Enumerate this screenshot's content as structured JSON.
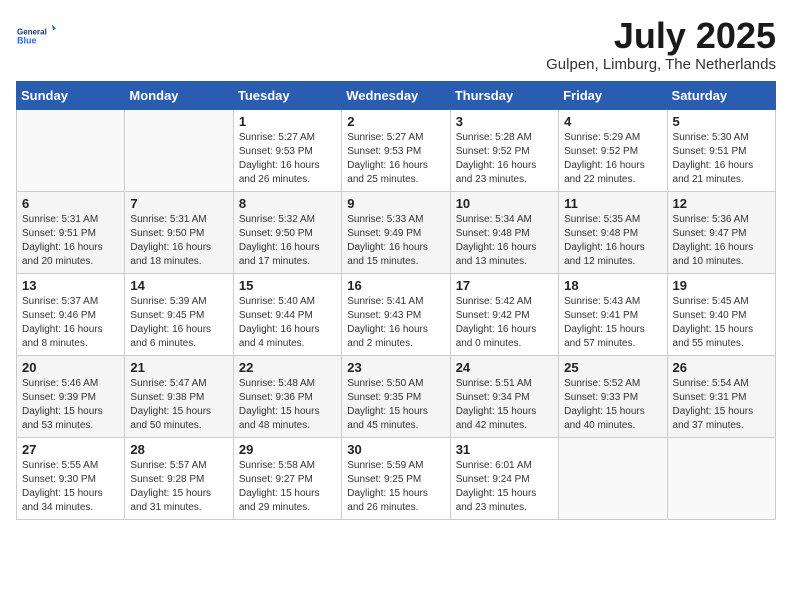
{
  "header": {
    "logo_line1": "General",
    "logo_line2": "Blue",
    "month_title": "July 2025",
    "location": "Gulpen, Limburg, The Netherlands"
  },
  "weekdays": [
    "Sunday",
    "Monday",
    "Tuesday",
    "Wednesday",
    "Thursday",
    "Friday",
    "Saturday"
  ],
  "weeks": [
    [
      {
        "day": "",
        "info": ""
      },
      {
        "day": "",
        "info": ""
      },
      {
        "day": "1",
        "info": "Sunrise: 5:27 AM\nSunset: 9:53 PM\nDaylight: 16 hours\nand 26 minutes."
      },
      {
        "day": "2",
        "info": "Sunrise: 5:27 AM\nSunset: 9:53 PM\nDaylight: 16 hours\nand 25 minutes."
      },
      {
        "day": "3",
        "info": "Sunrise: 5:28 AM\nSunset: 9:52 PM\nDaylight: 16 hours\nand 23 minutes."
      },
      {
        "day": "4",
        "info": "Sunrise: 5:29 AM\nSunset: 9:52 PM\nDaylight: 16 hours\nand 22 minutes."
      },
      {
        "day": "5",
        "info": "Sunrise: 5:30 AM\nSunset: 9:51 PM\nDaylight: 16 hours\nand 21 minutes."
      }
    ],
    [
      {
        "day": "6",
        "info": "Sunrise: 5:31 AM\nSunset: 9:51 PM\nDaylight: 16 hours\nand 20 minutes."
      },
      {
        "day": "7",
        "info": "Sunrise: 5:31 AM\nSunset: 9:50 PM\nDaylight: 16 hours\nand 18 minutes."
      },
      {
        "day": "8",
        "info": "Sunrise: 5:32 AM\nSunset: 9:50 PM\nDaylight: 16 hours\nand 17 minutes."
      },
      {
        "day": "9",
        "info": "Sunrise: 5:33 AM\nSunset: 9:49 PM\nDaylight: 16 hours\nand 15 minutes."
      },
      {
        "day": "10",
        "info": "Sunrise: 5:34 AM\nSunset: 9:48 PM\nDaylight: 16 hours\nand 13 minutes."
      },
      {
        "day": "11",
        "info": "Sunrise: 5:35 AM\nSunset: 9:48 PM\nDaylight: 16 hours\nand 12 minutes."
      },
      {
        "day": "12",
        "info": "Sunrise: 5:36 AM\nSunset: 9:47 PM\nDaylight: 16 hours\nand 10 minutes."
      }
    ],
    [
      {
        "day": "13",
        "info": "Sunrise: 5:37 AM\nSunset: 9:46 PM\nDaylight: 16 hours\nand 8 minutes."
      },
      {
        "day": "14",
        "info": "Sunrise: 5:39 AM\nSunset: 9:45 PM\nDaylight: 16 hours\nand 6 minutes."
      },
      {
        "day": "15",
        "info": "Sunrise: 5:40 AM\nSunset: 9:44 PM\nDaylight: 16 hours\nand 4 minutes."
      },
      {
        "day": "16",
        "info": "Sunrise: 5:41 AM\nSunset: 9:43 PM\nDaylight: 16 hours\nand 2 minutes."
      },
      {
        "day": "17",
        "info": "Sunrise: 5:42 AM\nSunset: 9:42 PM\nDaylight: 16 hours\nand 0 minutes."
      },
      {
        "day": "18",
        "info": "Sunrise: 5:43 AM\nSunset: 9:41 PM\nDaylight: 15 hours\nand 57 minutes."
      },
      {
        "day": "19",
        "info": "Sunrise: 5:45 AM\nSunset: 9:40 PM\nDaylight: 15 hours\nand 55 minutes."
      }
    ],
    [
      {
        "day": "20",
        "info": "Sunrise: 5:46 AM\nSunset: 9:39 PM\nDaylight: 15 hours\nand 53 minutes."
      },
      {
        "day": "21",
        "info": "Sunrise: 5:47 AM\nSunset: 9:38 PM\nDaylight: 15 hours\nand 50 minutes."
      },
      {
        "day": "22",
        "info": "Sunrise: 5:48 AM\nSunset: 9:36 PM\nDaylight: 15 hours\nand 48 minutes."
      },
      {
        "day": "23",
        "info": "Sunrise: 5:50 AM\nSunset: 9:35 PM\nDaylight: 15 hours\nand 45 minutes."
      },
      {
        "day": "24",
        "info": "Sunrise: 5:51 AM\nSunset: 9:34 PM\nDaylight: 15 hours\nand 42 minutes."
      },
      {
        "day": "25",
        "info": "Sunrise: 5:52 AM\nSunset: 9:33 PM\nDaylight: 15 hours\nand 40 minutes."
      },
      {
        "day": "26",
        "info": "Sunrise: 5:54 AM\nSunset: 9:31 PM\nDaylight: 15 hours\nand 37 minutes."
      }
    ],
    [
      {
        "day": "27",
        "info": "Sunrise: 5:55 AM\nSunset: 9:30 PM\nDaylight: 15 hours\nand 34 minutes."
      },
      {
        "day": "28",
        "info": "Sunrise: 5:57 AM\nSunset: 9:28 PM\nDaylight: 15 hours\nand 31 minutes."
      },
      {
        "day": "29",
        "info": "Sunrise: 5:58 AM\nSunset: 9:27 PM\nDaylight: 15 hours\nand 29 minutes."
      },
      {
        "day": "30",
        "info": "Sunrise: 5:59 AM\nSunset: 9:25 PM\nDaylight: 15 hours\nand 26 minutes."
      },
      {
        "day": "31",
        "info": "Sunrise: 6:01 AM\nSunset: 9:24 PM\nDaylight: 15 hours\nand 23 minutes."
      },
      {
        "day": "",
        "info": ""
      },
      {
        "day": "",
        "info": ""
      }
    ]
  ]
}
